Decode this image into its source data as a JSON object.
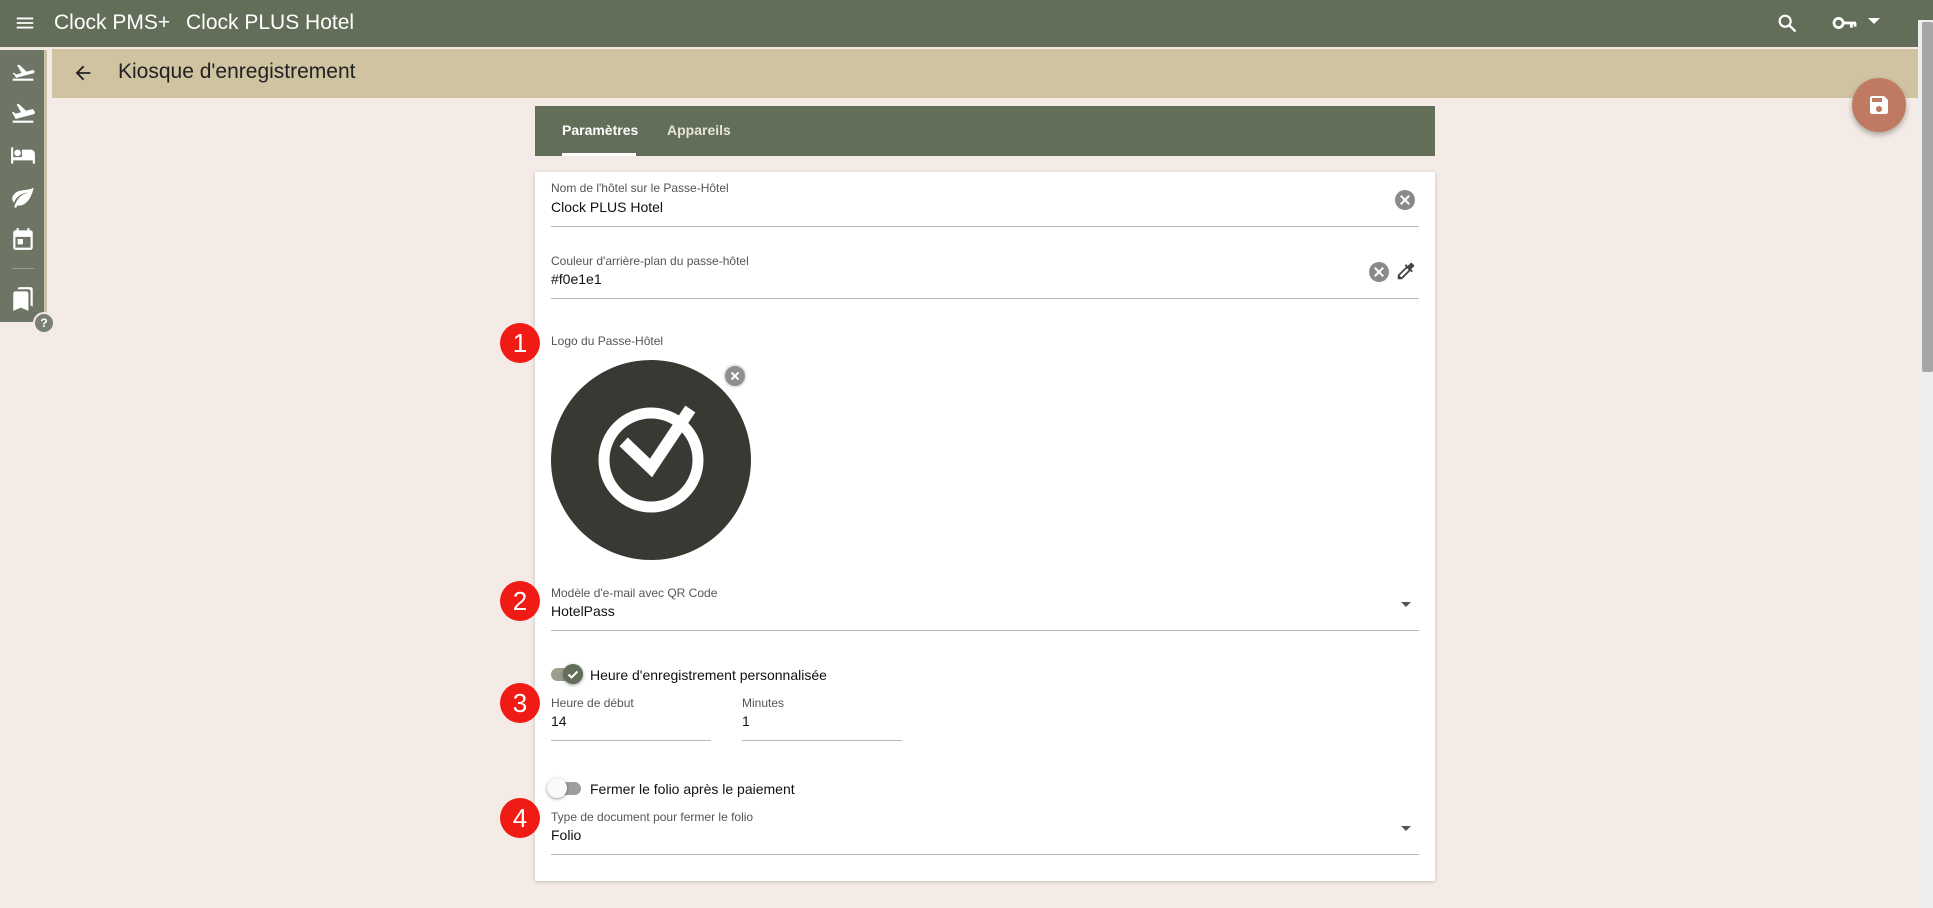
{
  "topbar": {
    "app_name": "Clock PMS+",
    "hotel_name": "Clock PLUS Hotel"
  },
  "subheader": {
    "title": "Kiosque d'enregistrement"
  },
  "tabs": [
    {
      "label": "Paramètres",
      "active": true
    },
    {
      "label": "Appareils",
      "active": false
    }
  ],
  "form": {
    "hotel_name_field": {
      "label": "Nom de l'hôtel sur le Passe-Hôtel",
      "value": "Clock PLUS Hotel"
    },
    "bg_color_field": {
      "label": "Couleur d'arrière-plan du passe-hôtel",
      "value": "#f0e1e1"
    },
    "logo": {
      "label": "Logo du Passe-Hôtel"
    },
    "email_template": {
      "label": "Modèle d'e-mail avec QR Code",
      "value": "HotelPass"
    },
    "custom_checkin_toggle": {
      "label": "Heure d'enregistrement personnalisée",
      "checked": true
    },
    "start_hour": {
      "label": "Heure de début",
      "value": "14"
    },
    "minutes": {
      "label": "Minutes",
      "value": "1"
    },
    "close_folio_toggle": {
      "label": "Fermer le folio après le paiement",
      "checked": false
    },
    "doc_type": {
      "label": "Type de document pour fermer le folio",
      "value": "Folio"
    }
  },
  "markers": [
    "1",
    "2",
    "3",
    "4"
  ],
  "colors": {
    "topbar": "#636e58",
    "subheader": "#cfc3a1",
    "background": "#f4ebe6",
    "fab": "#c07a62",
    "marker": "#f11b15"
  }
}
